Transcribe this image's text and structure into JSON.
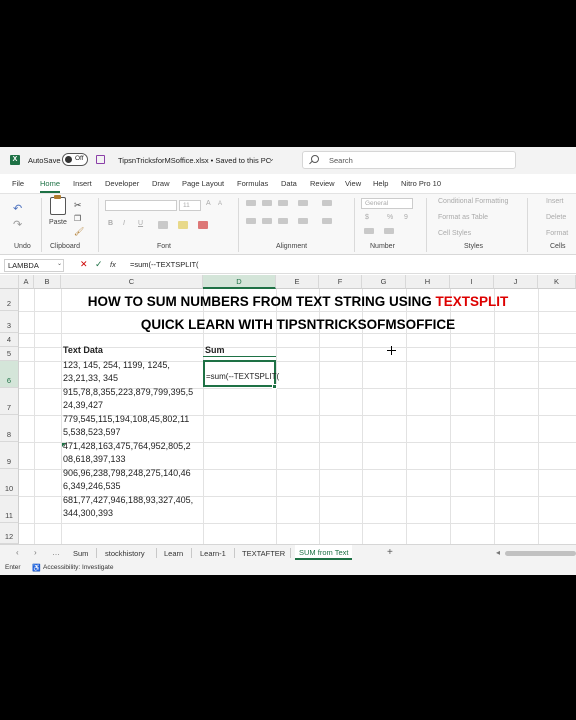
{
  "titlebar": {
    "logo": "X",
    "autosave_label": "AutoSave",
    "toggle_state": "Off",
    "filename": "TipsnTricksforMSoffice.xlsx  •  Saved to this PC",
    "chevron": "⌄",
    "search_placeholder": "Search"
  },
  "menu_tabs": [
    "File",
    "Home",
    "Insert",
    "Developer",
    "Draw",
    "Page Layout",
    "Formulas",
    "Data",
    "Review",
    "View",
    "Help",
    "Nitro Pro 10"
  ],
  "active_menu_tab": "Home",
  "ribbon": {
    "groups": [
      "Undo",
      "Clipboard",
      "Font",
      "Alignment",
      "Number",
      "Styles",
      "Cells"
    ],
    "paste_label": "Paste",
    "font_name": "",
    "font_size": "11",
    "number_format": "General",
    "conditional_formatting": "Conditional Formatting",
    "format_as_table": "Format as Table",
    "cell_styles": "Cell Styles",
    "insert": "Insert",
    "delete": "Delete",
    "format": "Format",
    "bold": "B",
    "italic": "I",
    "underline": "U",
    "percent": "%",
    "currency": "$",
    "comma": "9"
  },
  "formula_bar": {
    "name_box": "LAMBDA",
    "cancel": "✕",
    "enter": "✓",
    "fx": "fx",
    "formula": "=sum(--TEXTSPLIT("
  },
  "columns": [
    "A",
    "B",
    "C",
    "D",
    "E",
    "F",
    "G",
    "H",
    "I",
    "J",
    "K"
  ],
  "rows": [
    "2",
    "3",
    "4",
    "5",
    "6",
    "7",
    "8",
    "9",
    "10",
    "11",
    "12"
  ],
  "sheet": {
    "title_line1_black": "HOW TO SUM NUMBERS FROM TEXT STRING USING ",
    "title_line1_red": "TEXTSPLIT",
    "title_line2": "QUICK LEARN WITH TIPSNTRICKSOFMSOFFICE",
    "header_text_data": "Text Data",
    "header_sum": "Sum",
    "active_cell_value": "=sum(--TEXTSPLIT(",
    "text_data": [
      [
        "123, 145, 254, 1199, 1245,",
        "23,21,33, 345"
      ],
      [
        "915,78,8,355,223,879,799,395,5",
        "24,39,427"
      ],
      [
        "779,545,115,194,108,45,802,11",
        "5,538,523,597"
      ],
      [
        "471,428,163,475,764,952,805,2",
        "08,618,397,133"
      ],
      [
        "906,96,238,798,248,275,140,46",
        "6,349,246,535"
      ],
      [
        "681,77,427,946,188,93,327,405,",
        "344,300,393"
      ]
    ]
  },
  "sheet_tabs": [
    "Sum",
    "stockhistory",
    "Learn",
    "Learn-1",
    "TEXTAFTER",
    "SUM from Text"
  ],
  "active_sheet_tab": "SUM from Text",
  "add_sheet": "+",
  "status": {
    "mode": "Enter",
    "accessibility": "Accessibility: Investigate"
  },
  "colors": {
    "excel_green": "#1e7145",
    "title_red": "#dd0000"
  }
}
